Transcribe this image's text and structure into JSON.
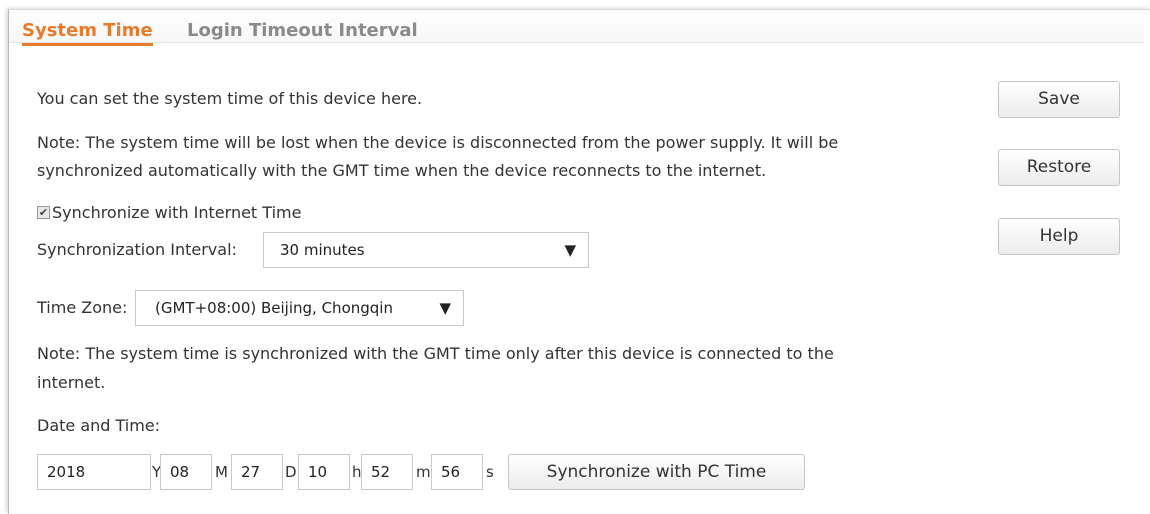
{
  "tabs": [
    {
      "label": "System Time",
      "active": true
    },
    {
      "label": "Login Timeout Interval",
      "active": false
    }
  ],
  "intro": "You can set the system time of this device here.",
  "note1_line1": "Note: The system time will be lost when the device is disconnected from the power supply. It will be",
  "note1_line2": "synchronized automatically with the GMT time when the device reconnects to the internet.",
  "sync_checkbox": {
    "label": "Synchronize with Internet Time",
    "checked": true
  },
  "sync_interval": {
    "label": "Synchronization Interval:",
    "value": "30 minutes"
  },
  "time_zone": {
    "label": "Time Zone:",
    "value": "(GMT+08:00) Beijing, Chongqin"
  },
  "note2_line1": "Note: The system time is synchronized with the GMT time only after this device is connected to the",
  "note2_line2": "internet.",
  "date_time": {
    "label": "Date and Time:",
    "year": "2018",
    "year_unit": "Y",
    "month": "08",
    "month_unit": "M",
    "day": "27",
    "day_unit": "D",
    "hour": "10",
    "hour_unit": "h",
    "minute": "52",
    "minute_unit": "m",
    "second": "56",
    "second_unit": "s",
    "sync_pc_button": "Synchronize with PC Time"
  },
  "buttons": {
    "save": "Save",
    "restore": "Restore",
    "help": "Help"
  },
  "colors": {
    "accent": "#e87a2c",
    "inactive_tab": "#8a8a8a"
  },
  "icons": {
    "dropdown": "triangle-down-icon",
    "checkbox": "checkmark-icon"
  }
}
